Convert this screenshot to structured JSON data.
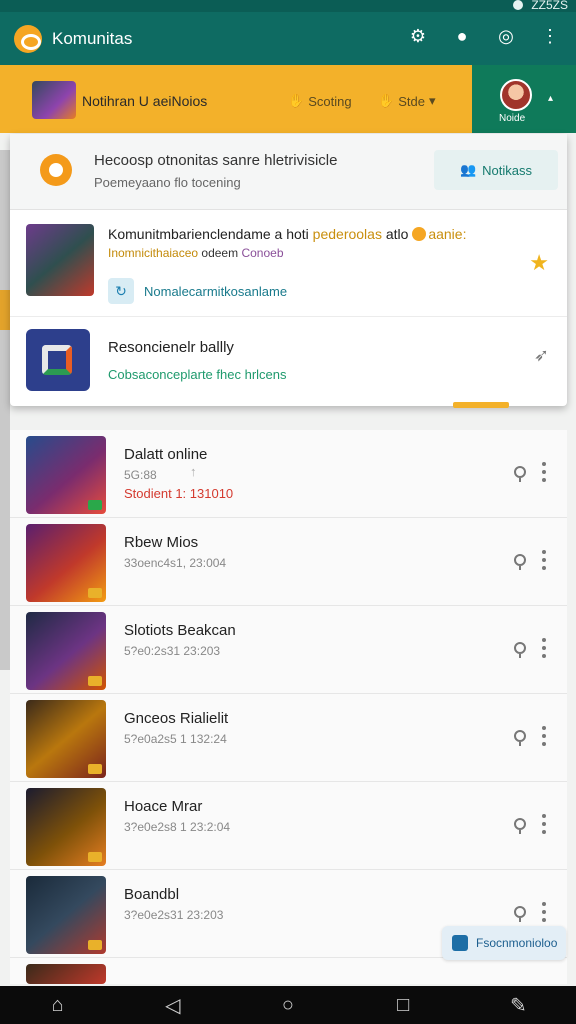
{
  "status_bar": {
    "right_text": "ZZ5ZS"
  },
  "app_bar": {
    "title": "Komunitas",
    "actions": [
      "settings-icon",
      "lightbulb-icon",
      "chat-icon",
      "more-vert-icon"
    ]
  },
  "section_bar": {
    "title": "Notihran  U aeiNoios",
    "sort_label": "Scoting",
    "state_label": "Stde",
    "user_label": "Noide"
  },
  "banner": {
    "title": "Hecoosp otnonitas sanre hletrivisicle",
    "subtitle": "Poemeyaano flo tocening",
    "button_label": "Notikass"
  },
  "featured": [
    {
      "title_start": "Komunitmbarienclendame a hoti",
      "title_accent": "pederoolas",
      "title_mid": "atlo",
      "title_end": "aanie:",
      "subtitle": "Inomnicithaiaceo",
      "subtitle_mid": "odeem",
      "subtitle_tail": "Conoeb",
      "link_label": "Nomalecarmitkosanlame"
    },
    {
      "title": "Resoncienelr ballly",
      "subtitle": "Cobsaconceplarte fhec hrlcens"
    }
  ],
  "list": [
    {
      "title": "Dalatt online",
      "subtitle": "5G:88",
      "extra": "Stodient 1: 131010"
    },
    {
      "title": "Rbew  Mios",
      "subtitle": "33oenc4s1, 23:004"
    },
    {
      "title": "Slotiots Beakcan",
      "subtitle": "5?e0:2s31 23:203"
    },
    {
      "title": "Gnceos Rialielit",
      "subtitle": "5?e0a2s5 1 132:24"
    },
    {
      "title": "Hoace  Mrar",
      "subtitle": "3?e0e2s8 1 23:2:04"
    },
    {
      "title": "Boandbl",
      "subtitle": "3?e0e2s31 23:203"
    }
  ],
  "fab": {
    "label": "Fsocnmonioloo"
  },
  "nav": [
    "home-icon",
    "back-icon",
    "circle-home-icon",
    "recents-icon",
    "edit-icon"
  ],
  "colors": {
    "teal": "#0e6b62",
    "amber": "#f3b12a",
    "green": "#0f7a5a"
  }
}
